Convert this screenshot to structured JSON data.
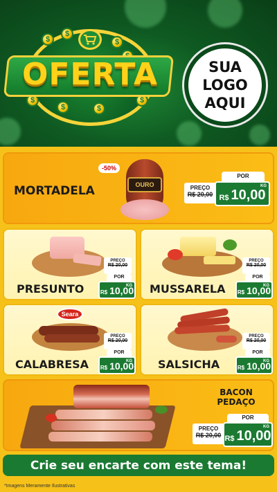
{
  "header": {
    "banner_title": "OFERTA",
    "logo_lines": [
      "SUA",
      "LOGO",
      "AQUI"
    ],
    "coin_symbol": "$"
  },
  "featured": {
    "name": "MORTADELA",
    "discount": "-50%",
    "brand_on_pack": "OURO",
    "preco_label": "PREÇO",
    "old_price": "R$ 20,00",
    "por_label": "POR",
    "currency": "R$",
    "price": "10,00",
    "unit": "KG"
  },
  "products": [
    {
      "name": "PRESUNTO",
      "preco_label": "PREÇO",
      "old_price": "R$ 20,00",
      "por_label": "POR",
      "currency": "R$",
      "price": "10,00",
      "unit": "KG"
    },
    {
      "name": "MUSSARELA",
      "preco_label": "PREÇO",
      "old_price": "R$ 20,00",
      "por_label": "POR",
      "currency": "R$",
      "price": "10,00",
      "unit": "KG"
    },
    {
      "name": "CALABRESA",
      "brand": "Seara",
      "preco_label": "PREÇO",
      "old_price": "R$ 20,00",
      "por_label": "POR",
      "currency": "R$",
      "price": "10,00",
      "unit": "KG"
    },
    {
      "name": "SALSICHA",
      "preco_label": "PREÇO",
      "old_price": "R$ 20,00",
      "por_label": "POR",
      "currency": "R$",
      "price": "10,00",
      "unit": "KG"
    }
  ],
  "bacon": {
    "name_line1": "BACON",
    "name_line2": "PEDAÇO",
    "preco_label": "PREÇO",
    "old_price": "R$ 20,00",
    "por_label": "POR",
    "currency": "R$",
    "price": "10,00",
    "unit": "KG"
  },
  "cta": "Crie seu encarte com este tema!",
  "footer_note": "*Imagens Meramente Ilustrativas",
  "colors": {
    "background_yellow": "#f6c21a",
    "header_green": "#0f5a22",
    "price_green": "#1b7a32",
    "banner_gold": "#ffd21a",
    "featured_orange": "#f7a80f"
  }
}
